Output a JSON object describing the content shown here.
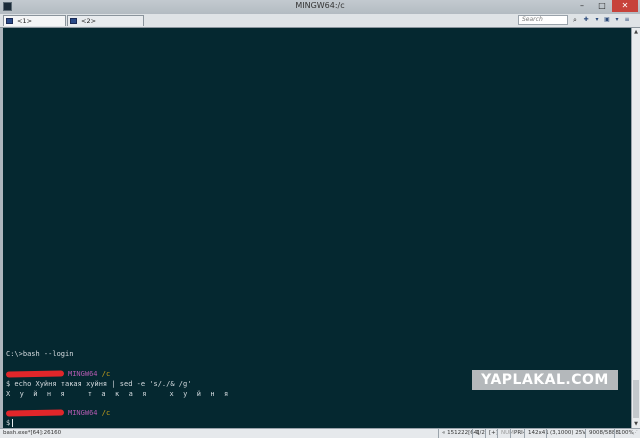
{
  "window": {
    "title": "MINGW64:/c",
    "controls": {
      "minimize": "–",
      "maximize": "□",
      "close": "✕"
    }
  },
  "tabs": [
    {
      "label": "<1> MINGW64:/c"
    },
    {
      "label": "<2> MINGW64:/c/dev/..."
    }
  ],
  "toolbar": {
    "search_placeholder": "Search"
  },
  "terminal": {
    "lines": {
      "cmd_prompt": "C:\\>bash --login",
      "prompt1_host": "MINGW64",
      "prompt1_path": "/c",
      "command": "$ echo Хуйня такая хуйня | sed -e 's/./& /g'",
      "output": "Х у й н я   т а к а я   х у й н я",
      "prompt2_host": "MINGW64",
      "prompt2_path": "/c",
      "current_prompt": "$"
    }
  },
  "watermark": "YAPLAKAL.COM",
  "statusbar": {
    "process": "bash.exe*[64]:26160",
    "position": "« 151222[64]",
    "tab_index": "1/2",
    "plus": "[+]",
    "num": "NUM",
    "pri": "PRI‹",
    "size": "142x41",
    "cursor": "(3,1000) 25V",
    "memory": "9008/5888",
    "zoom": "100%"
  },
  "colors": {
    "terminal_bg": "#052830",
    "prompt_host": "#b35ab0",
    "prompt_path": "#c8a11a",
    "redaction": "#e1262a"
  }
}
